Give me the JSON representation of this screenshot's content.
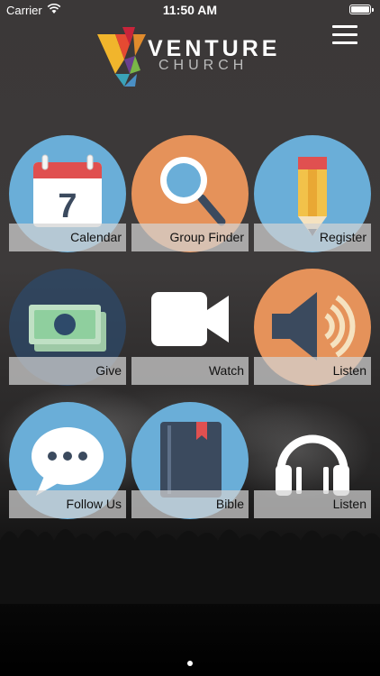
{
  "status_bar": {
    "carrier": "Carrier",
    "time": "11:50 AM",
    "battery_level": 1.0
  },
  "header": {
    "logo_line1": "VENTURE",
    "logo_line2": "CHURCH",
    "menu_icon": "hamburger-menu-icon"
  },
  "tiles": [
    {
      "label": "Calendar",
      "icon": "calendar-icon",
      "color": "#6aaed8"
    },
    {
      "label": "Group Finder",
      "icon": "magnifier-icon",
      "color": "#e5925a"
    },
    {
      "label": "Register",
      "icon": "pencil-icon",
      "color": "#6aaed8"
    },
    {
      "label": "Give",
      "icon": "money-icon",
      "color": "#2e4a6a"
    },
    {
      "label": "Watch",
      "icon": "video-camera-icon",
      "color": ""
    },
    {
      "label": "Listen",
      "icon": "speaker-icon",
      "color": "#e5925a"
    },
    {
      "label": "Follow Us",
      "icon": "chat-bubble-icon",
      "color": "#6aaed8"
    },
    {
      "label": "Bible",
      "icon": "book-icon",
      "color": "#6aaed8"
    },
    {
      "label": "Listen",
      "icon": "headphones-icon",
      "color": ""
    }
  ],
  "pager": {
    "pages": 1,
    "current": 1
  }
}
